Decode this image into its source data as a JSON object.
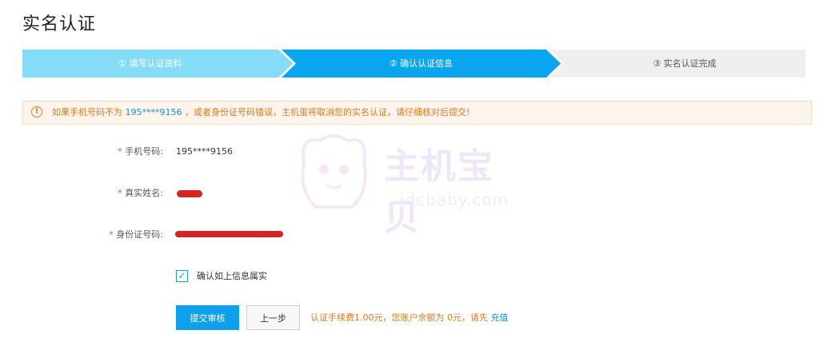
{
  "page": {
    "title": "实名认证"
  },
  "steps": [
    {
      "label": "① 填写认证资料",
      "state": "done"
    },
    {
      "label": "② 确认认证信息",
      "state": "active"
    },
    {
      "label": "③ 实名认证完成",
      "state": "todo"
    }
  ],
  "alert": {
    "icon": "warning-icon",
    "text_before": "如果手机号码不为",
    "phone": "195****9156",
    "text_after": "，或者身份证号码错误，主机蛋将取消您的实名认证，请仔细核对后提交!"
  },
  "form": {
    "phone": {
      "label": "手机号码:",
      "value": "195****9156"
    },
    "name": {
      "label": "真实姓名:"
    },
    "id_number": {
      "label": "身份证号码:"
    },
    "confirm_label": "确认如上信息属实",
    "confirm_checked": true
  },
  "actions": {
    "submit_label": "提交审核",
    "prev_label": "上一步",
    "fee_text": "认证手续费1.00元，您账户余额为 0元，请先",
    "recharge_label": "充值"
  },
  "watermark": {
    "brand": "主机宝贝",
    "url": "idcbaby.com"
  },
  "colors": {
    "step_done": "#85dcf7",
    "step_active": "#09a6ef",
    "step_todo": "#efefef",
    "alert_text": "#e4791c",
    "link": "#1a8fd6",
    "primary_button": "#0ea0ec",
    "required": "#e2523a"
  }
}
